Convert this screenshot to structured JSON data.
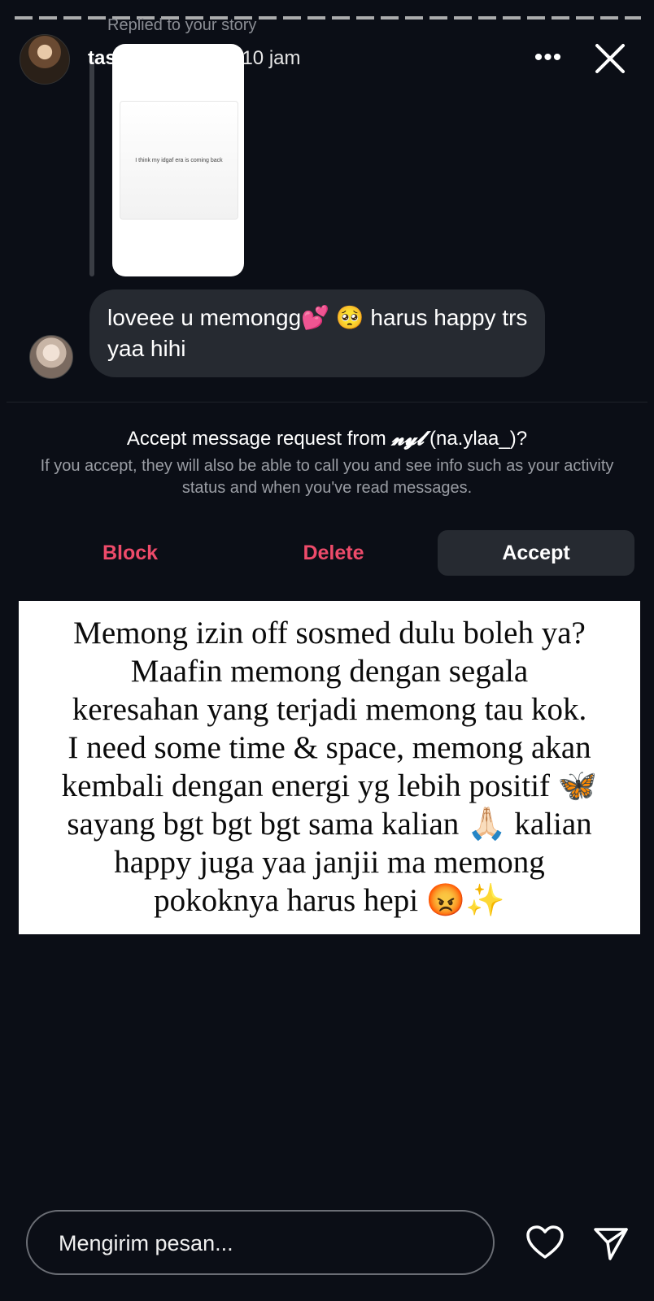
{
  "story": {
    "reply_label": "Replied to your story",
    "username": "tasyafarasya",
    "time": "10 jam",
    "thumbnail_text": "I think my idgaf era is coming back"
  },
  "message": {
    "text": "loveee u memongg💕 🥺 harus happy trs yaa hihi"
  },
  "request": {
    "title_prefix": "Accept message request from ",
    "display_name": "𝓷𝔂𝓵",
    "title_suffix": " (na.ylaa_)?",
    "description": "If you accept, they will also be able to call you and see info such as your activity status and when you've read messages."
  },
  "buttons": {
    "block": "Block",
    "delete": "Delete",
    "accept": "Accept"
  },
  "story_text": {
    "line1": "Memong izin off sosmed dulu boleh ya?",
    "line2": "Maafin memong dengan segala",
    "line3": "keresahan yang terjadi memong tau kok.",
    "line4": "I need some time & space, memong akan",
    "line5": "kembali dengan energi yg lebih positif 🦋",
    "line6": "sayang bgt bgt bgt sama kalian 🙏🏻 kalian",
    "line7": "happy juga yaa janjii ma memong",
    "line8": "pokoknya harus hepi 😡✨"
  },
  "footer": {
    "placeholder": "Mengirim pesan..."
  },
  "colors": {
    "background": "#0b0e16",
    "bubble": "#262a31",
    "destructive": "#ee4b6a"
  }
}
